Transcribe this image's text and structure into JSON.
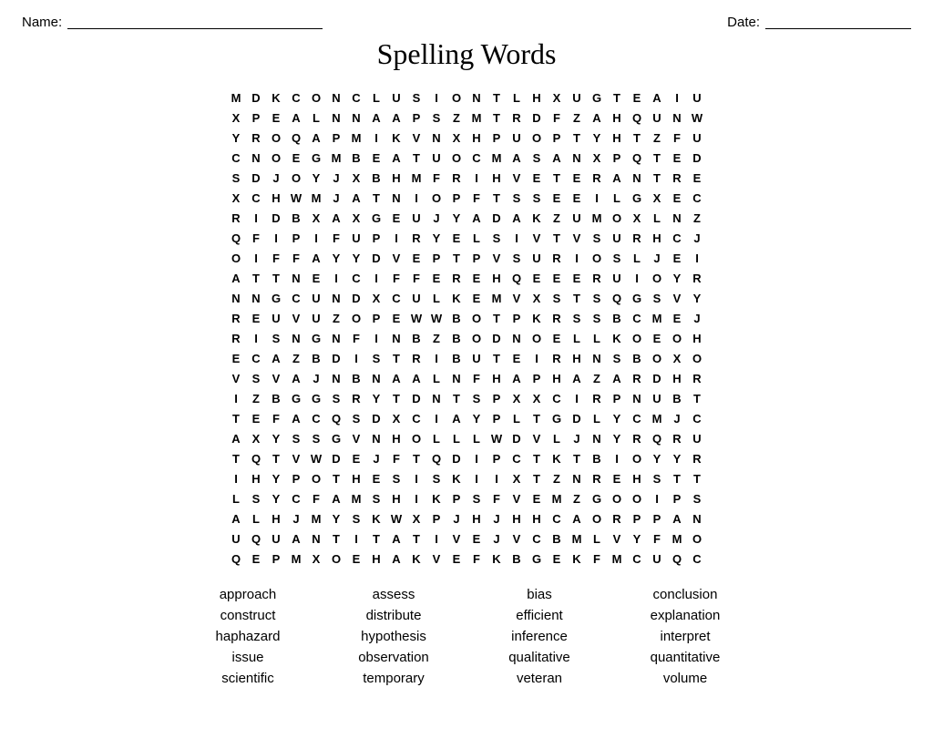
{
  "header": {
    "name_label": "Name:",
    "date_label": "Date:"
  },
  "title": "Spelling Words",
  "grid": [
    [
      "M",
      "D",
      "K",
      "C",
      "O",
      "N",
      "C",
      "L",
      "U",
      "S",
      "I",
      "O",
      "N",
      "T",
      "L",
      "H",
      "X",
      "U",
      "G",
      "T",
      "E",
      "A",
      "I",
      "U"
    ],
    [
      "X",
      "P",
      "E",
      "A",
      "L",
      "N",
      "N",
      "A",
      "A",
      "P",
      "S",
      "Z",
      "M",
      "T",
      "R",
      "D",
      "F",
      "Z",
      "A",
      "H",
      "Q",
      "U",
      "N",
      "W"
    ],
    [
      "Y",
      "R",
      "O",
      "Q",
      "A",
      "P",
      "M",
      "I",
      "K",
      "V",
      "N",
      "X",
      "H",
      "P",
      "U",
      "O",
      "P",
      "T",
      "Y",
      "H",
      "T",
      "Z",
      "F",
      "U"
    ],
    [
      "C",
      "N",
      "O",
      "E",
      "G",
      "M",
      "B",
      "E",
      "A",
      "T",
      "U",
      "O",
      "C",
      "M",
      "A",
      "S",
      "A",
      "N",
      "X",
      "P",
      "Q",
      "T",
      "E",
      "D"
    ],
    [
      "S",
      "D",
      "J",
      "O",
      "Y",
      "J",
      "X",
      "B",
      "H",
      "M",
      "F",
      "R",
      "I",
      "H",
      "V",
      "E",
      "T",
      "E",
      "R",
      "A",
      "N",
      "T",
      "R",
      "E"
    ],
    [
      "X",
      "C",
      "H",
      "W",
      "M",
      "J",
      "A",
      "T",
      "N",
      "I",
      "O",
      "P",
      "F",
      "T",
      "S",
      "S",
      "E",
      "E",
      "I",
      "L",
      "G",
      "X",
      "E",
      "C"
    ],
    [
      "R",
      "I",
      "D",
      "B",
      "X",
      "A",
      "X",
      "G",
      "E",
      "U",
      "J",
      "Y",
      "A",
      "D",
      "A",
      "K",
      "Z",
      "U",
      "M",
      "O",
      "X",
      "L",
      "N",
      "Z"
    ],
    [
      "Q",
      "F",
      "I",
      "P",
      "I",
      "F",
      "U",
      "P",
      "I",
      "R",
      "Y",
      "E",
      "L",
      "S",
      "I",
      "V",
      "T",
      "V",
      "S",
      "U",
      "R",
      "H",
      "C",
      "J"
    ],
    [
      "O",
      "I",
      "F",
      "F",
      "A",
      "Y",
      "Y",
      "D",
      "V",
      "E",
      "P",
      "T",
      "P",
      "V",
      "S",
      "U",
      "R",
      "I",
      "O",
      "S",
      "L",
      "J",
      "E",
      "I"
    ],
    [
      "A",
      "T",
      "T",
      "N",
      "E",
      "I",
      "C",
      "I",
      "F",
      "F",
      "E",
      "R",
      "E",
      "H",
      "Q",
      "E",
      "E",
      "E",
      "R",
      "U",
      "I",
      "O",
      "Y",
      "R"
    ],
    [
      "N",
      "N",
      "G",
      "C",
      "U",
      "N",
      "D",
      "X",
      "C",
      "U",
      "L",
      "K",
      "E",
      "M",
      "V",
      "X",
      "S",
      "T",
      "S",
      "Q",
      "G",
      "S",
      "V",
      "Y"
    ],
    [
      "R",
      "E",
      "U",
      "V",
      "U",
      "Z",
      "O",
      "P",
      "E",
      "W",
      "W",
      "B",
      "O",
      "T",
      "P",
      "K",
      "R",
      "S",
      "S",
      "B",
      "C",
      "M",
      "E",
      "J"
    ],
    [
      "R",
      "I",
      "S",
      "N",
      "G",
      "N",
      "F",
      "I",
      "N",
      "B",
      "Z",
      "B",
      "O",
      "D",
      "N",
      "O",
      "E",
      "L",
      "L",
      "K",
      "O",
      "E",
      "O",
      "H"
    ],
    [
      "E",
      "C",
      "A",
      "Z",
      "B",
      "D",
      "I",
      "S",
      "T",
      "R",
      "I",
      "B",
      "U",
      "T",
      "E",
      "I",
      "R",
      "H",
      "N",
      "S",
      "B",
      "O",
      "X",
      "O"
    ],
    [
      "V",
      "S",
      "V",
      "A",
      "J",
      "N",
      "B",
      "N",
      "A",
      "A",
      "L",
      "N",
      "F",
      "H",
      "A",
      "P",
      "H",
      "A",
      "Z",
      "A",
      "R",
      "D",
      "H",
      "R"
    ],
    [
      "I",
      "Z",
      "B",
      "G",
      "G",
      "S",
      "R",
      "Y",
      "T",
      "D",
      "N",
      "T",
      "S",
      "P",
      "X",
      "X",
      "C",
      "I",
      "R",
      "P",
      "N",
      "U",
      "B",
      "T"
    ],
    [
      "T",
      "E",
      "F",
      "A",
      "C",
      "Q",
      "S",
      "D",
      "X",
      "C",
      "I",
      "A",
      "Y",
      "P",
      "L",
      "T",
      "G",
      "D",
      "L",
      "Y",
      "C",
      "M",
      "J",
      "C"
    ],
    [
      "A",
      "X",
      "Y",
      "S",
      "S",
      "G",
      "V",
      "N",
      "H",
      "O",
      "L",
      "L",
      "L",
      "W",
      "D",
      "V",
      "L",
      "J",
      "N",
      "Y",
      "R",
      "Q",
      "R",
      "U"
    ],
    [
      "T",
      "Q",
      "T",
      "V",
      "W",
      "D",
      "E",
      "J",
      "F",
      "T",
      "Q",
      "D",
      "I",
      "P",
      "C",
      "T",
      "K",
      "T",
      "B",
      "I",
      "O",
      "Y",
      "Y",
      "R"
    ],
    [
      "I",
      "H",
      "Y",
      "P",
      "O",
      "T",
      "H",
      "E",
      "S",
      "I",
      "S",
      "K",
      "I",
      "I",
      "X",
      "T",
      "Z",
      "N",
      "R",
      "E",
      "H",
      "S",
      "T",
      "T"
    ],
    [
      "L",
      "S",
      "Y",
      "C",
      "F",
      "A",
      "M",
      "S",
      "H",
      "I",
      "K",
      "P",
      "S",
      "F",
      "V",
      "E",
      "M",
      "Z",
      "G",
      "O",
      "O",
      "I",
      "P",
      "S"
    ],
    [
      "A",
      "L",
      "H",
      "J",
      "M",
      "Y",
      "S",
      "K",
      "W",
      "X",
      "P",
      "J",
      "H",
      "J",
      "H",
      "H",
      "C",
      "A",
      "O",
      "R",
      "P",
      "P",
      "A",
      "N"
    ],
    [
      "U",
      "Q",
      "U",
      "A",
      "N",
      "T",
      "I",
      "T",
      "A",
      "T",
      "I",
      "V",
      "E",
      "J",
      "V",
      "C",
      "B",
      "M",
      "L",
      "V",
      "Y",
      "F",
      "M",
      "O"
    ],
    [
      "Q",
      "E",
      "P",
      "M",
      "X",
      "O",
      "E",
      "H",
      "A",
      "K",
      "V",
      "E",
      "F",
      "K",
      "B",
      "G",
      "E",
      "K",
      "F",
      "M",
      "C",
      "U",
      "Q",
      "C"
    ]
  ],
  "word_rows": [
    [
      "approach",
      "assess",
      "bias",
      "conclusion"
    ],
    [
      "construct",
      "distribute",
      "efficient",
      "explanation"
    ],
    [
      "haphazard",
      "hypothesis",
      "inference",
      "interpret"
    ],
    [
      "issue",
      "observation",
      "qualitative",
      "quantitative"
    ],
    [
      "scientific",
      "temporary",
      "veteran",
      "volume"
    ]
  ]
}
